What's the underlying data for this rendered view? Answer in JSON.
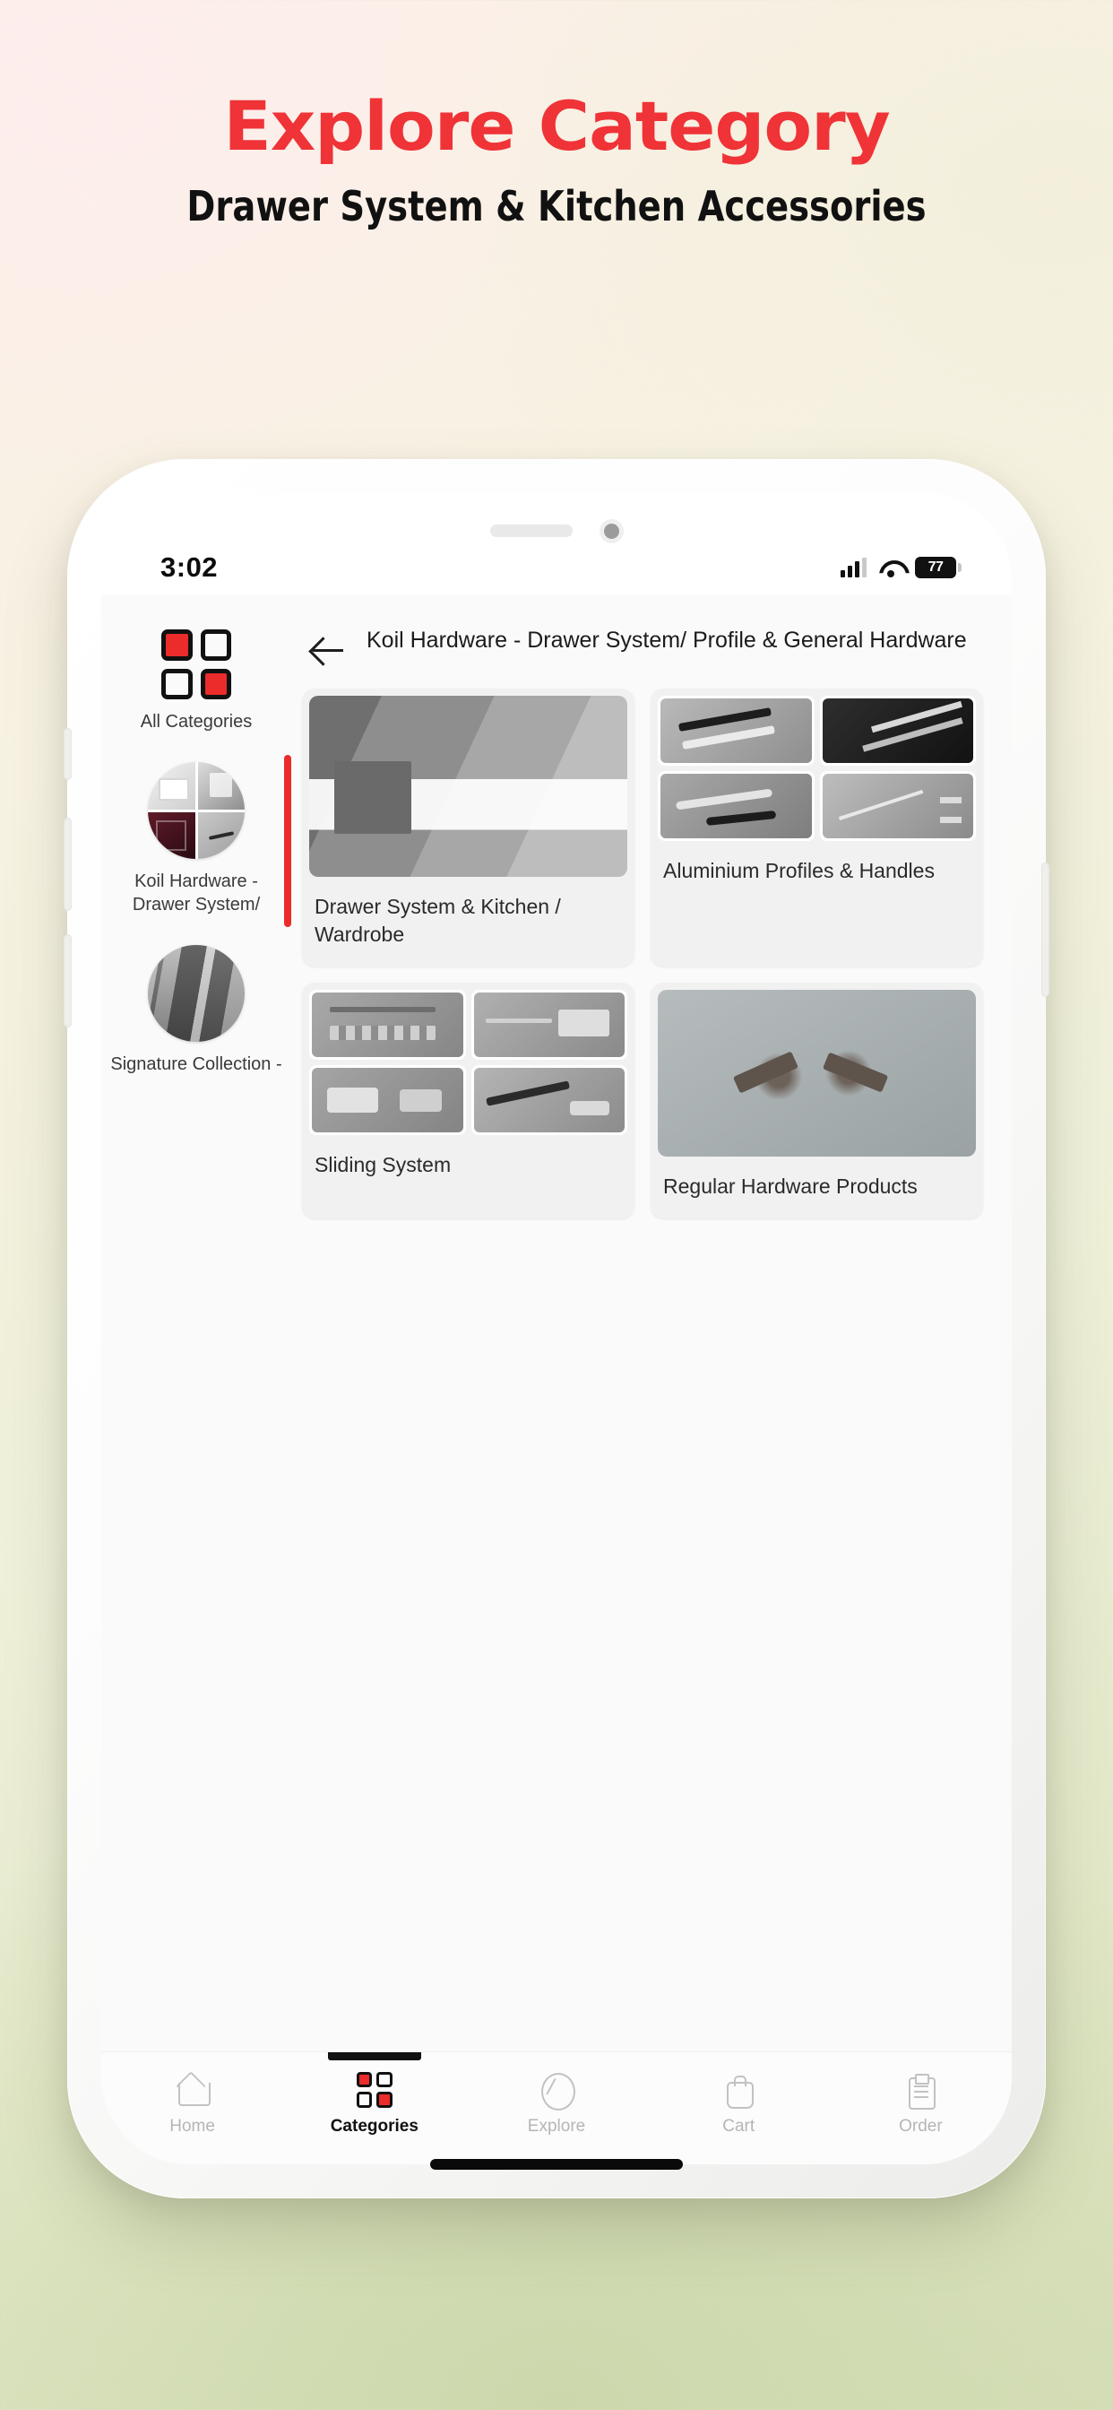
{
  "poster": {
    "title": "Explore Category",
    "subtitle": "Drawer System & Kitchen Accessories",
    "title_color": "#ef3337",
    "subtitle_color": "#111111"
  },
  "status_bar": {
    "time": "3:02",
    "battery_percent": "77",
    "signal_icon": "cellular-signal-icon",
    "wifi_icon": "wifi-icon",
    "battery_icon": "battery-icon"
  },
  "app_header": {
    "back_icon": "back-arrow-icon",
    "title": "Koil Hardware - Drawer System/ Profile & General Hardware"
  },
  "sidebar": {
    "items": [
      {
        "label": "All Categories",
        "icon": "grid-icon",
        "active": false
      },
      {
        "label": "Koil Hardware - Drawer System/",
        "icon": "category-thumbnail",
        "active": true
      },
      {
        "label": "Signature Collection -",
        "icon": "category-thumbnail",
        "active": false
      }
    ]
  },
  "categories": [
    {
      "caption": "Drawer System & Kitchen / Wardrobe",
      "thumb_type": "single",
      "thumb_name": "drawer-system-photo"
    },
    {
      "caption": "Aluminium Profiles & Handles",
      "thumb_type": "quad",
      "thumb_name": "aluminium-profiles-photo-grid"
    },
    {
      "caption": "Sliding System",
      "thumb_type": "quad",
      "thumb_name": "sliding-system-photo-grid"
    },
    {
      "caption": "Regular Hardware Products",
      "thumb_type": "single",
      "thumb_name": "hinges-photo"
    }
  ],
  "bottom_nav": {
    "items": [
      {
        "label": "Home",
        "icon": "home-icon",
        "active": false
      },
      {
        "label": "Categories",
        "icon": "grid-icon",
        "active": true
      },
      {
        "label": "Explore",
        "icon": "compass-icon",
        "active": false
      },
      {
        "label": "Cart",
        "icon": "cart-icon",
        "active": false
      },
      {
        "label": "Order",
        "icon": "clipboard-icon",
        "active": false
      }
    ]
  },
  "colors": {
    "accent_red": "#ec2b2b",
    "poster_red": "#ef3337",
    "app_bg": "#fafafa",
    "card_bg": "#f1f1f1"
  }
}
